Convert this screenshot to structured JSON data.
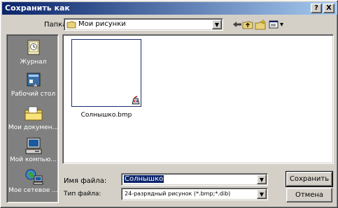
{
  "window": {
    "title": "Сохранить как",
    "help_label": "?",
    "close_label": "X"
  },
  "location": {
    "label": "Папка:",
    "value": "Мои рисунки",
    "dropdown_arrow": "▼"
  },
  "toolbar": {
    "icons": [
      "back-arrow-icon",
      "up-folder-icon",
      "new-folder-icon",
      "view-menu-icon"
    ],
    "back_glyph": "←",
    "view_menu_arrow": "▾"
  },
  "places": [
    {
      "label": "Журнал",
      "icon": "history-icon"
    },
    {
      "label": "Рабочий стол",
      "icon": "desktop-icon"
    },
    {
      "label": "Мои докумен...",
      "icon": "my-documents-icon"
    },
    {
      "label": "Мой компью...",
      "icon": "my-computer-icon"
    },
    {
      "label": "Мое сетевое ...",
      "icon": "network-places-icon"
    }
  ],
  "files": [
    {
      "name": "Солнышко.bmp",
      "icon": "paint-bitmap-icon"
    }
  ],
  "filename": {
    "label": "Имя файла:",
    "value": "Солнышко",
    "dropdown_arrow": "▼"
  },
  "filetype": {
    "label": "Тип файла:",
    "value": "24-разрядный рисунок (*.bmp;*.dib)",
    "dropdown_arrow": "▼"
  },
  "buttons": {
    "save": "Сохранить",
    "cancel": "Отмена"
  },
  "colors": {
    "title_start": "#0a246a",
    "title_end": "#a6caf0",
    "face": "#d4d0c8",
    "places_bg": "#808080"
  }
}
